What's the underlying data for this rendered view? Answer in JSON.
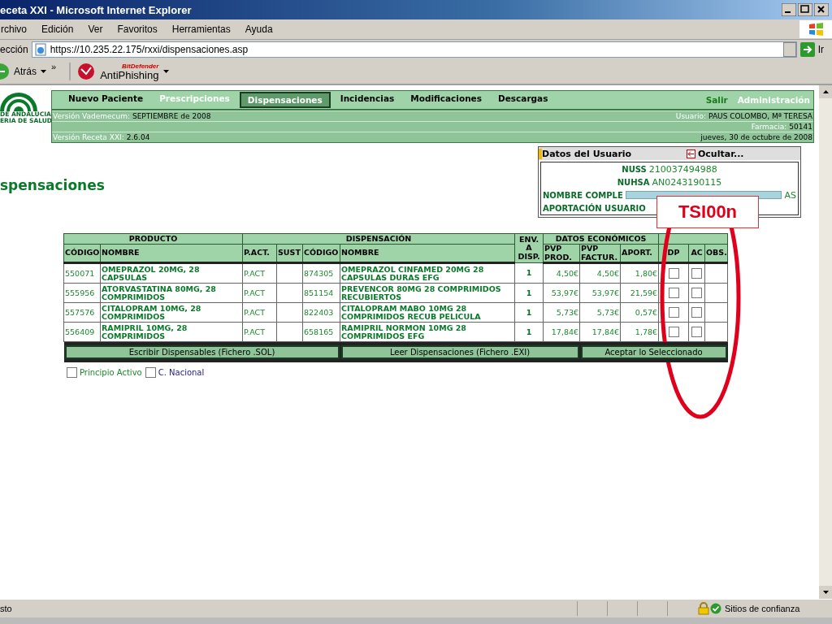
{
  "window": {
    "title": "eceta XXI - Microsoft Internet Explorer"
  },
  "menu": [
    "rchivo",
    "Edición",
    "Ver",
    "Favoritos",
    "Herramientas",
    "Ayuda"
  ],
  "address": {
    "label": "ección",
    "url": "https://10.235.22.175/rxxi/dispensaciones.asp",
    "go": "Ir"
  },
  "toolbar": {
    "back": "Atrás",
    "more": "»",
    "plugin_brand": "BitDefender",
    "plugin_name": "AntiPhishing"
  },
  "logo": {
    "line1": "DE ANDALUCIA",
    "line2": "ERIA DE SALUD"
  },
  "nav": {
    "items": [
      {
        "label": "Nuevo Paciente",
        "selected": false,
        "disabled": false
      },
      {
        "label": "Prescripciones",
        "selected": false,
        "disabled": true
      },
      {
        "label": "Dispensaciones",
        "selected": true,
        "disabled": false
      },
      {
        "label": "Incidencias",
        "selected": false,
        "disabled": false
      },
      {
        "label": "Modificaciones",
        "selected": false,
        "disabled": false
      },
      {
        "label": "Descargas",
        "selected": false,
        "disabled": false
      }
    ],
    "right": [
      {
        "label": "Salir",
        "disabled": false
      },
      {
        "label": "Administración",
        "disabled": true
      }
    ]
  },
  "info": {
    "vademecum_label": "Versión Vademecum:",
    "vademecum": "SEPTIEMBRE de 2008",
    "version_label": "Versión Receta XXI:",
    "version": "2.6.04",
    "user_label": "Usuario:",
    "user": "PAUS COLOMBO, Mª TERESA",
    "pharmacy_label": "Farmacia:",
    "pharmacy": "50141",
    "date": "jueves, 30 de octubre de 2008"
  },
  "user_panel": {
    "title": "Datos del Usuario",
    "hide": "Ocultar...",
    "fields": [
      {
        "label": "NUSS",
        "value": "210037494988",
        "kind": "plain"
      },
      {
        "label": "NUHSA",
        "value": "AN0243190115",
        "kind": "plain"
      },
      {
        "label": "NOMBRE COMPLE",
        "value": "AS",
        "kind": "redacted"
      },
      {
        "label": "APORTACIÓN USUARIO",
        "kind": "covered"
      }
    ]
  },
  "page_title": "spensaciones",
  "table": {
    "groups": [
      "PRODUCTO",
      "DISPENSACIÓN",
      "ENV. A DISP.",
      "DATOS ECONÓMICOS"
    ],
    "columns": [
      "CÓDIGO",
      "NOMBRE",
      "P.ACT.",
      "SUST",
      "CÓDIGO",
      "NOMBRE",
      "PVP PROD.",
      "PVP FACTUR.",
      "APORT.",
      "DP",
      "AC",
      "OBS."
    ],
    "rows": [
      {
        "code": "550071",
        "name": "OMEPRAZOL 20MG, 28 CAPSULAS",
        "pact": "P.ACT",
        "code2": "874305",
        "name2": "OMEPRAZOL CINFAMED 20MG 28 CAPSULAS DURAS EFG",
        "qty": "1",
        "pvp": "4,50€",
        "factur": "4,50€",
        "aport": "1,80€",
        "dp": false,
        "ac": false
      },
      {
        "code": "555956",
        "name": "ATORVASTATINA 80MG, 28 COMPRIMIDOS",
        "pact": "P.ACT",
        "code2": "851154",
        "name2": "PREVENCOR 80MG 28 COMPRIMIDOS RECUBIERTOS",
        "qty": "1",
        "pvp": "53,97€",
        "factur": "53,97€",
        "aport": "21,59€",
        "dp": false,
        "ac": false
      },
      {
        "code": "557576",
        "name": "CITALOPRAM 10MG, 28 COMPRIMIDOS",
        "pact": "P.ACT",
        "code2": "822403",
        "name2": "CITALOPRAM MABO 10MG 28 COMPRIMIDOS RECUB PELICULA",
        "qty": "1",
        "pvp": "5,73€",
        "factur": "5,73€",
        "aport": "0,57€",
        "dp": false,
        "ac": false
      },
      {
        "code": "556409",
        "name": "RAMIPRIL 10MG, 28 COMPRIMIDOS",
        "pact": "P.ACT",
        "code2": "658165",
        "name2": "RAMIPRIL NORMON 10MG 28 COMPRIMIDOS EFG",
        "qty": "1",
        "pvp": "17,84€",
        "factur": "17,84€",
        "aport": "1,78€",
        "dp": false,
        "ac": false
      }
    ],
    "buttons": [
      "Escribir Dispensables (Fichero .SOL)",
      "Leer Dispensaciones (Fichero .EXI)",
      "Aceptar lo Seleccionado"
    ]
  },
  "filters": [
    {
      "label": "Principio Activo",
      "checked": false
    },
    {
      "label": "C. Nacional",
      "checked": false
    }
  ],
  "annotation": {
    "text": "TSI00n"
  },
  "status_bar": {
    "text": "sto",
    "zone": "Sitios de confianza"
  }
}
